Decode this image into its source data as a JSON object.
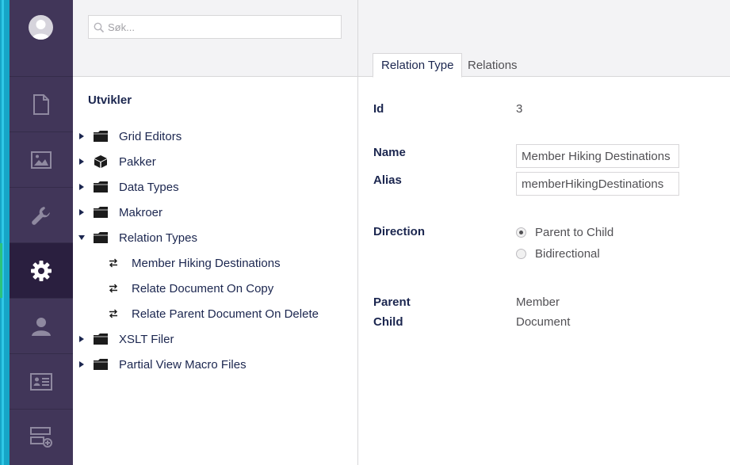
{
  "rail": {
    "items": [
      {
        "icon": "document-icon",
        "label": "Content"
      },
      {
        "icon": "image-icon",
        "label": "Media"
      },
      {
        "icon": "wrench-icon",
        "label": "Settings"
      },
      {
        "icon": "gear-icon",
        "label": "Developer",
        "active": true
      },
      {
        "icon": "user-icon",
        "label": "Users"
      },
      {
        "icon": "id-card-icon",
        "label": "Members"
      },
      {
        "icon": "forms-add-icon",
        "label": "Forms"
      }
    ],
    "accent_color": "#16a5c7",
    "active_color": "#2bc37c",
    "background": "#413659"
  },
  "search": {
    "placeholder": "Søk..."
  },
  "tree": {
    "title": "Utvikler",
    "items": [
      {
        "label": "Grid Editors",
        "icon": "folder-icon",
        "expanded": false
      },
      {
        "label": "Pakker",
        "icon": "package-icon",
        "expanded": false
      },
      {
        "label": "Data Types",
        "icon": "folder-icon",
        "expanded": false
      },
      {
        "label": "Makroer",
        "icon": "folder-icon",
        "expanded": false
      },
      {
        "label": "Relation Types",
        "icon": "folder-icon",
        "expanded": true
      },
      {
        "label": "Member Hiking Destinations",
        "icon": "swap-arrows-icon",
        "child": true
      },
      {
        "label": "Relate Document On Copy",
        "icon": "swap-arrows-icon",
        "child": true
      },
      {
        "label": "Relate Parent Document On Delete",
        "icon": "swap-arrows-icon",
        "child": true
      },
      {
        "label": "XSLT Filer",
        "icon": "folder-icon",
        "expanded": false
      },
      {
        "label": "Partial View Macro Files",
        "icon": "folder-icon",
        "expanded": false
      }
    ]
  },
  "tabs": [
    {
      "label": "Relation Type",
      "active": true
    },
    {
      "label": "Relations",
      "active": false
    }
  ],
  "form": {
    "id_label": "Id",
    "id_value": "3",
    "name_label": "Name",
    "name_value": "Member Hiking Destinations",
    "alias_label": "Alias",
    "alias_value": "memberHikingDestinations",
    "direction_label": "Direction",
    "direction_options": [
      {
        "label": "Parent to Child",
        "checked": true
      },
      {
        "label": "Bidirectional",
        "checked": false
      }
    ],
    "parent_label": "Parent",
    "parent_value": "Member",
    "child_label": "Child",
    "child_value": "Document"
  }
}
